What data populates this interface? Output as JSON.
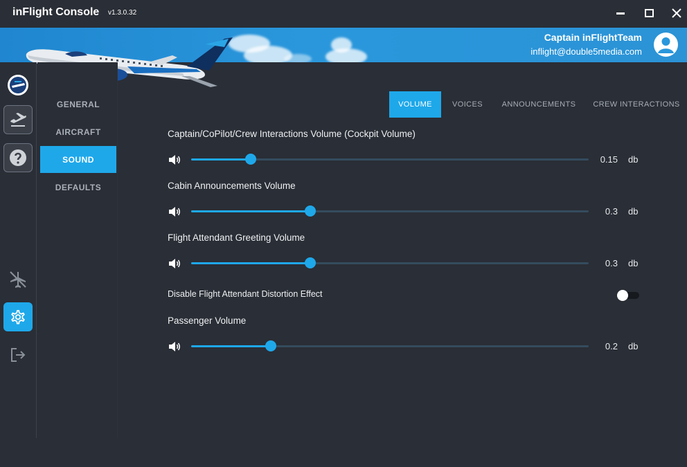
{
  "window": {
    "title": "inFlight Console",
    "version": "v1.3.0.32",
    "controls": [
      "minimize-icon",
      "maximize-icon",
      "close-icon"
    ]
  },
  "user": {
    "name": "Captain inFlightTeam",
    "email": "inflight@double5media.com",
    "avatar_icon": "user-avatar-icon"
  },
  "rail": {
    "items": [
      {
        "icon": "airline-logo-icon"
      },
      {
        "icon": "departure-icon"
      },
      {
        "icon": "help-icon"
      },
      {
        "icon": "no-flight-icon"
      },
      {
        "icon": "gear-icon",
        "active": true
      },
      {
        "icon": "logout-icon"
      }
    ]
  },
  "subnav": {
    "items": [
      {
        "label": "GENERAL"
      },
      {
        "label": "AIRCRAFT"
      },
      {
        "label": "SOUND",
        "active": true
      },
      {
        "label": "DEFAULTS"
      }
    ]
  },
  "tabs": [
    {
      "label": "VOLUME",
      "active": true
    },
    {
      "label": "VOICES"
    },
    {
      "label": "ANNOUNCEMENTS"
    },
    {
      "label": "CREW INTERACTIONS"
    }
  ],
  "settings": {
    "cockpit": {
      "label": "Captain/CoPilot/Crew Interactions Volume (Cockpit Volume)",
      "value": "0.15",
      "unit": "db",
      "level": 0.15
    },
    "cabin": {
      "label": "Cabin Announcements Volume",
      "value": "0.3",
      "unit": "db",
      "level": 0.3
    },
    "greeting": {
      "label": "Flight Attendant Greeting Volume",
      "value": "0.3",
      "unit": "db",
      "level": 0.3
    },
    "distortion": {
      "label": "Disable Flight Attendant Distortion Effect",
      "enabled": false
    },
    "passenger": {
      "label": "Passenger Volume",
      "value": "0.2",
      "unit": "db",
      "level": 0.2
    }
  },
  "colors": {
    "accent": "#1ea8ea",
    "background": "#2a2e36",
    "banner": "#2a97dc"
  }
}
